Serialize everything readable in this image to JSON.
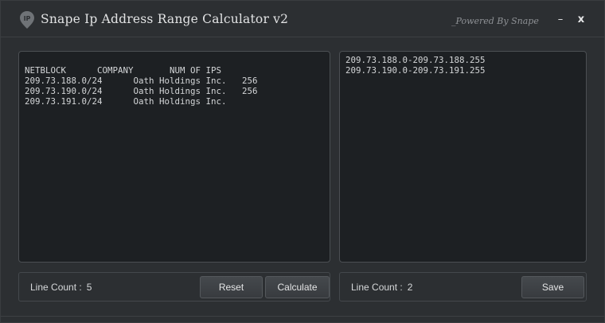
{
  "window": {
    "title": "Snape Ip Address Range Calculator v2",
    "powered_by": "_Powered By Snape",
    "minimize_label": "–",
    "close_label": "x",
    "icon": "map-pin-logo-icon"
  },
  "input_panel": {
    "content": "NETBLOCK      COMPANY       NUM OF IPS\n209.73.188.0/24      Oath Holdings Inc.   256\n209.73.190.0/24      Oath Holdings Inc.   256\n209.73.191.0/24      Oath Holdings Inc.",
    "line_count_label": "Line Count :",
    "line_count_value": "5",
    "reset_label": "Reset",
    "calculate_label": "Calculate"
  },
  "output_panel": {
    "content": "209.73.188.0-209.73.188.255\n209.73.190.0-209.73.191.255",
    "line_count_label": "Line Count :",
    "line_count_value": "2",
    "save_label": "Save"
  },
  "colors": {
    "background": "#2c2f32",
    "textarea_bg": "#1d2023",
    "text": "#d6d8da"
  }
}
